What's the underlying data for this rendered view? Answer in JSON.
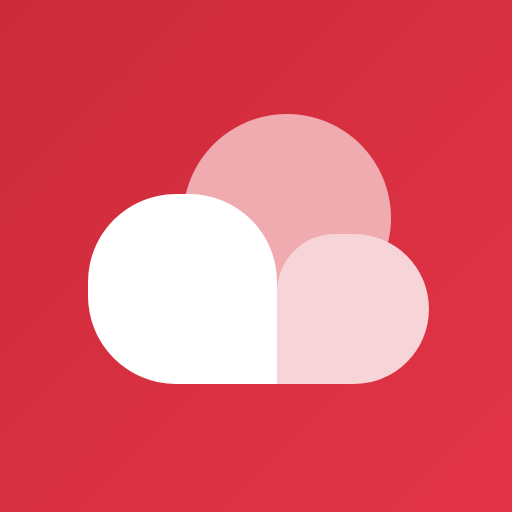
{
  "icon": {
    "name": "cloud-icon",
    "colors": {
      "background_start": "#CC2B3A",
      "background_end": "#E23447",
      "back_circle": "#EFABB0",
      "right_lobe": "#F6D4D7",
      "left_lobe": "#FFFFFF"
    }
  }
}
